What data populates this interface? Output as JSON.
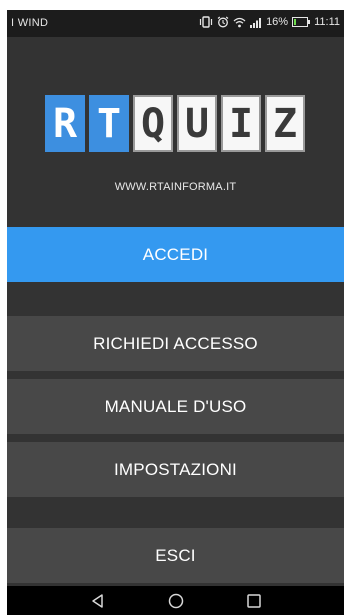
{
  "status_bar": {
    "carrier": "I WIND",
    "battery_percent": "16%",
    "battery_level": 0.16,
    "time": "11:11",
    "icons": [
      "vibrate-icon",
      "alarm-icon",
      "wifi-icon",
      "signal-icon",
      "battery-charging-icon"
    ]
  },
  "logo": {
    "letters": [
      "R",
      "T",
      "Q",
      "U",
      "I",
      "Z"
    ],
    "colors": {
      "blue": "#3d8fe0",
      "white": "#f7f7f7"
    }
  },
  "website": "WWW.RTAINFORMA.IT",
  "menu": {
    "login": "ACCEDI",
    "request_access": "RICHIEDI ACCESSO",
    "user_manual": "MANUALE D'USO",
    "settings": "IMPOSTAZIONI",
    "exit": "ESCI"
  },
  "colors": {
    "accent": "#3499f0",
    "background": "#333333",
    "button": "#484848"
  },
  "nav_bar": [
    "back-icon",
    "home-icon",
    "recents-icon"
  ]
}
